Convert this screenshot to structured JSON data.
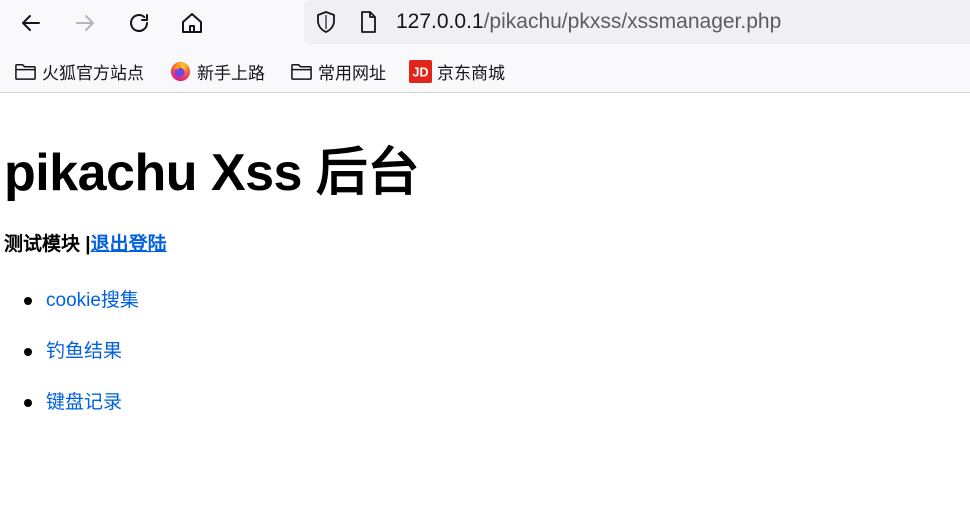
{
  "browser": {
    "nav": {
      "back_icon": "back-arrow-icon",
      "forward_icon": "forward-arrow-icon",
      "reload_icon": "reload-icon",
      "home_icon": "home-icon"
    },
    "urlbar": {
      "host": "127.0.0.1",
      "path": "/pikachu/pkxss/xssmanager.php",
      "shield_icon": "tracking-shield-icon",
      "page_icon": "page-document-icon"
    },
    "bookmarks": [
      {
        "label": "火狐官方站点",
        "icon": "folder-icon"
      },
      {
        "label": "新手上路",
        "icon": "firefox-logo-icon"
      },
      {
        "label": "常用网址",
        "icon": "folder-icon"
      },
      {
        "label": "京东商城",
        "icon": "jd-logo-icon"
      }
    ]
  },
  "page": {
    "title": "pikachu Xss 后台",
    "subtitle": "测试模块 |",
    "logout_link": "退出登陆",
    "menu": [
      {
        "label": "cookie搜集"
      },
      {
        "label": "钓鱼结果"
      },
      {
        "label": "键盘记录"
      }
    ]
  },
  "colors": {
    "link": "#0060df",
    "toolbar_bg": "#f9f9fb",
    "urlbar_bg": "#f0f0f4",
    "jd_red": "#e1251b"
  }
}
